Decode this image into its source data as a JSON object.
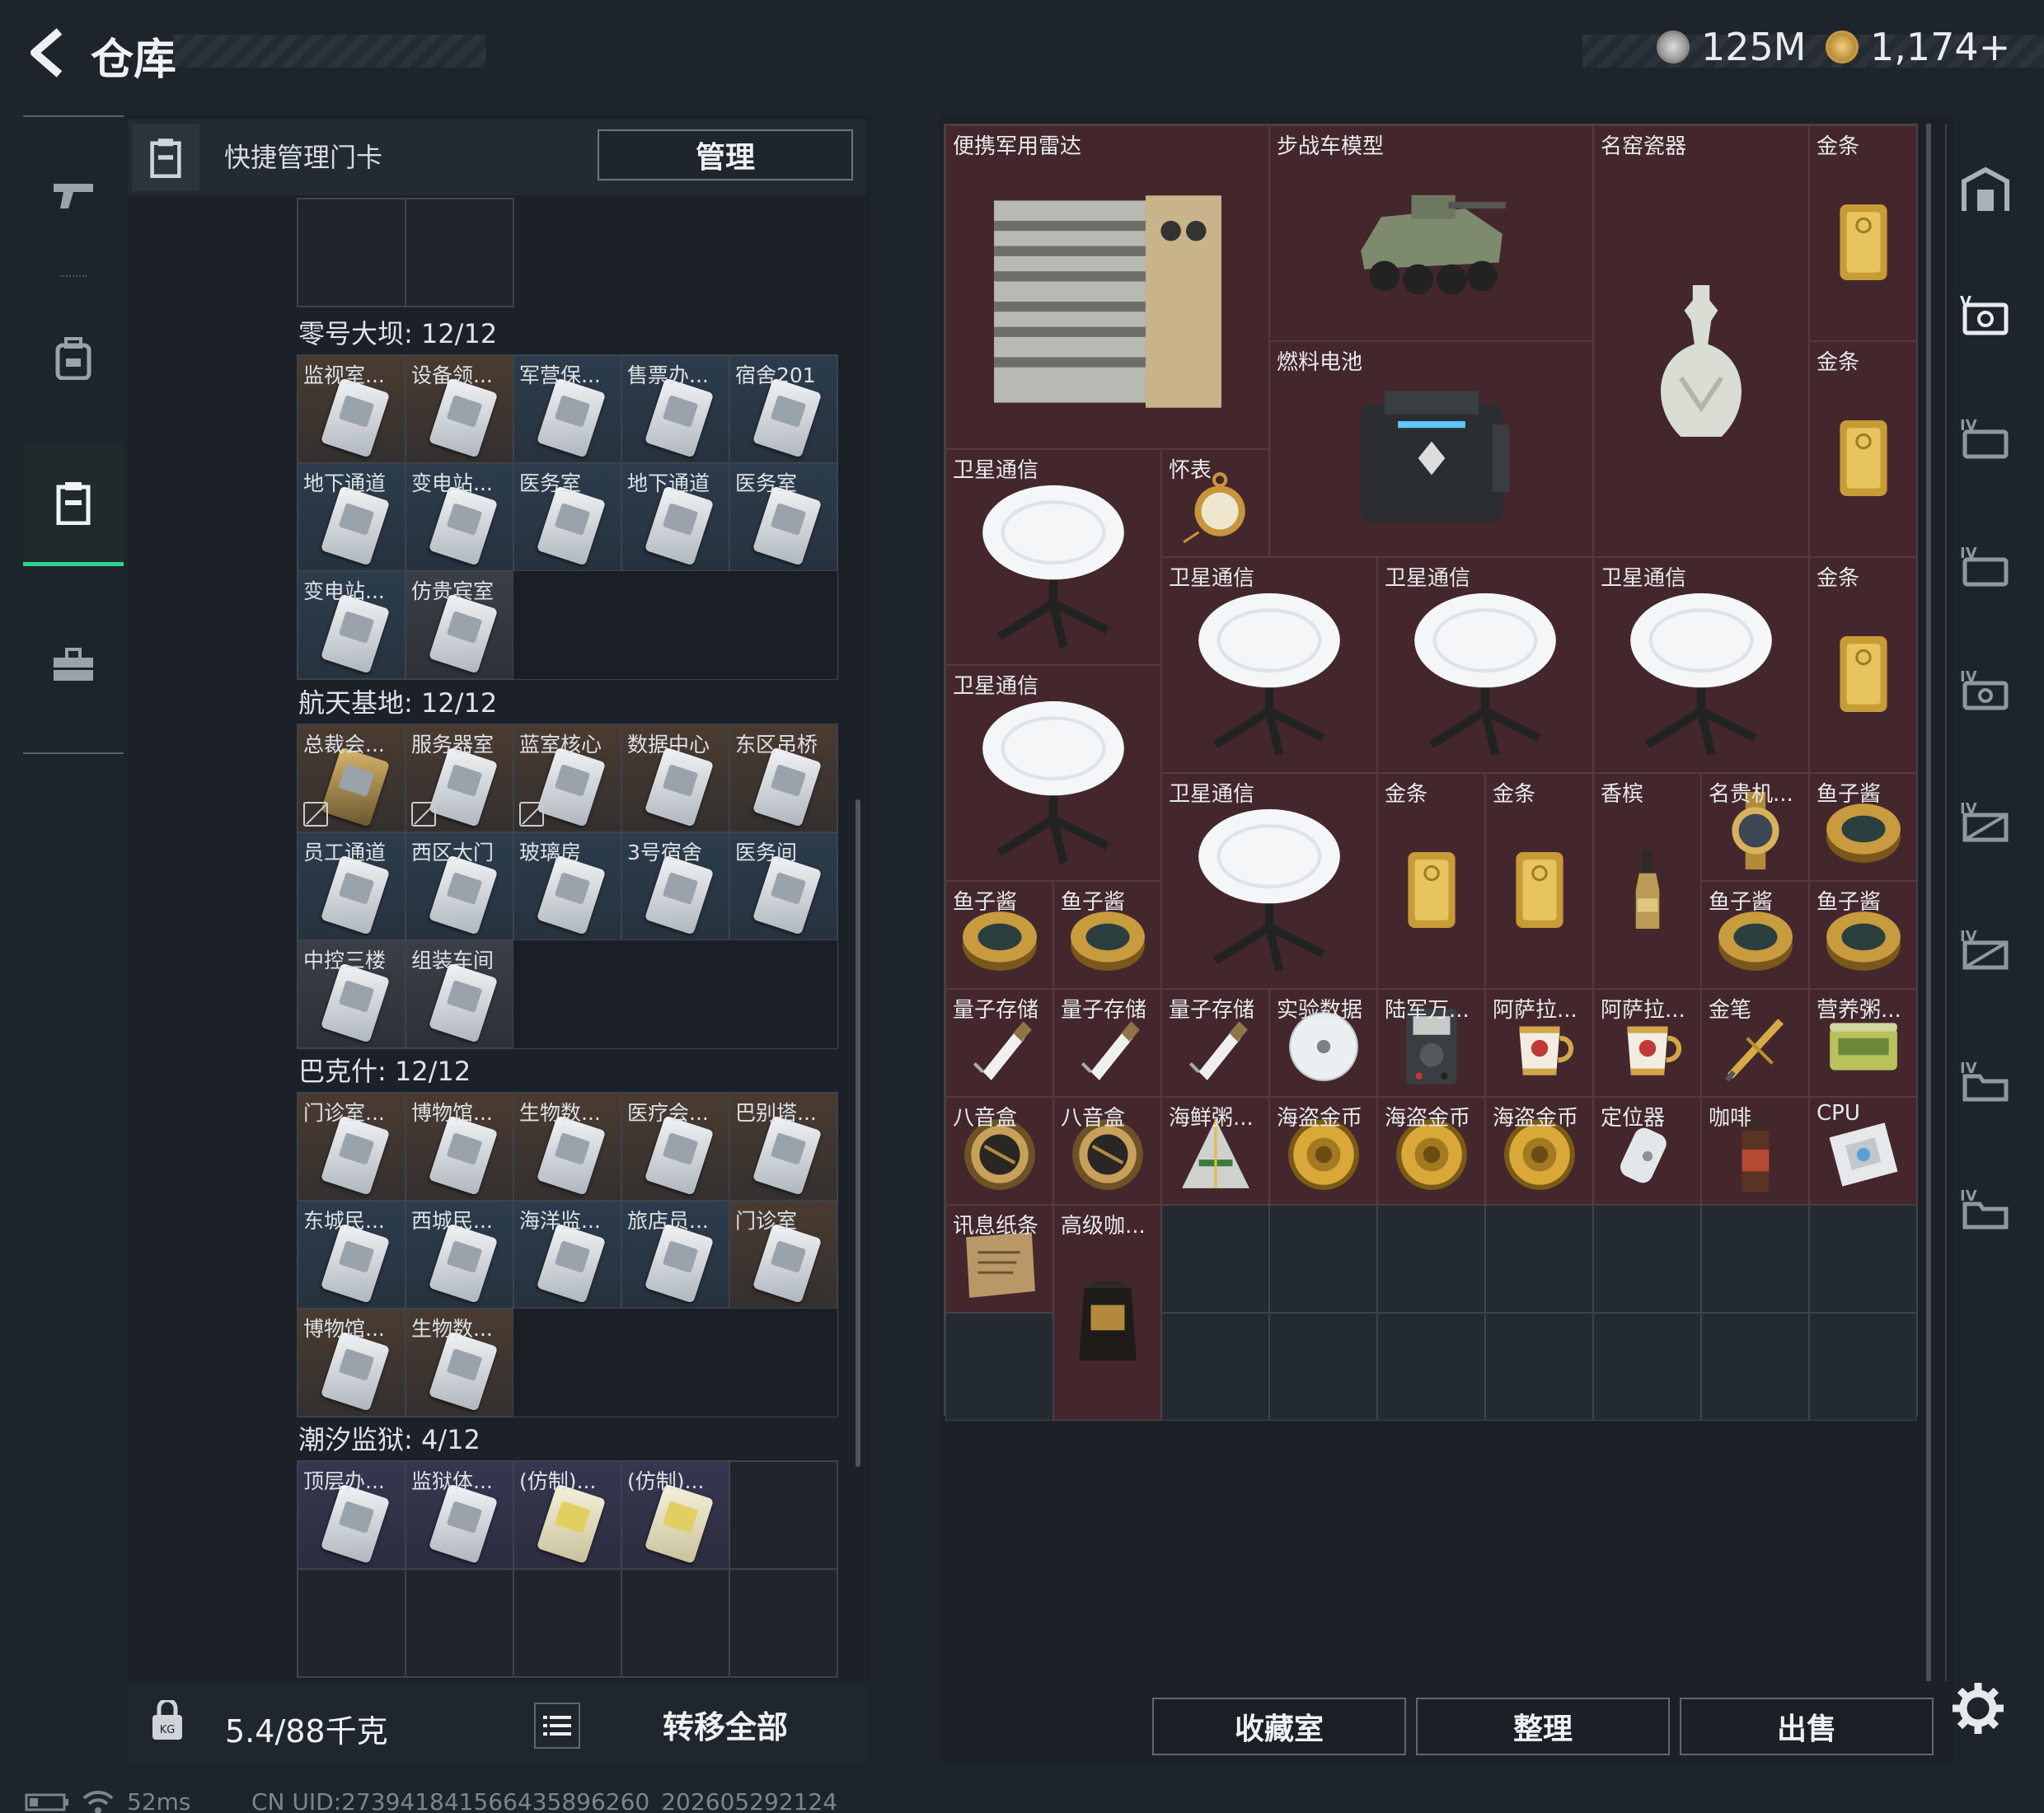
{
  "header": {
    "title": "仓库",
    "currency1": "125M",
    "currency2": "1,174+"
  },
  "left_panel": {
    "header_label": "快捷管理门卡",
    "manage_label": "管理",
    "sections": [
      {
        "title": "零号大坝: 12/12",
        "cards": [
          {
            "label": "监视室...",
            "tone": "brown"
          },
          {
            "label": "设备领...",
            "tone": "brown"
          },
          {
            "label": "军营保...",
            "tone": "blue"
          },
          {
            "label": "售票办...",
            "tone": "blue"
          },
          {
            "label": "宿舍201",
            "tone": "blue"
          },
          {
            "label": "地下通道",
            "tone": "blue"
          },
          {
            "label": "变电站...",
            "tone": "blue"
          },
          {
            "label": "医务室",
            "tone": "blue"
          },
          {
            "label": "地下通道",
            "tone": "blue"
          },
          {
            "label": "医务室",
            "tone": "blue"
          },
          {
            "label": "变电站...",
            "tone": "blue"
          },
          {
            "label": "仿贵宾室",
            "tone": "gray"
          }
        ]
      },
      {
        "title": "航天基地: 12/12",
        "cards": [
          {
            "label": "总裁会...",
            "tone": "brown",
            "gold": true,
            "key": true
          },
          {
            "label": "服务器室",
            "tone": "brown",
            "key": true
          },
          {
            "label": "蓝室核心",
            "tone": "brown",
            "key": true
          },
          {
            "label": "数据中心",
            "tone": "brown"
          },
          {
            "label": "东区吊桥",
            "tone": "brown"
          },
          {
            "label": "员工通道",
            "tone": "blue"
          },
          {
            "label": "西区大门",
            "tone": "blue"
          },
          {
            "label": "玻璃房",
            "tone": "blue"
          },
          {
            "label": "3号宿舍",
            "tone": "blue"
          },
          {
            "label": "医务间",
            "tone": "blue"
          },
          {
            "label": "中控三楼",
            "tone": "gray"
          },
          {
            "label": "组装车间",
            "tone": "gray"
          }
        ]
      },
      {
        "title": "巴克什: 12/12",
        "cards": [
          {
            "label": "门诊室...",
            "tone": "brown"
          },
          {
            "label": "博物馆...",
            "tone": "brown"
          },
          {
            "label": "生物数...",
            "tone": "brown"
          },
          {
            "label": "医疗会...",
            "tone": "brown"
          },
          {
            "label": "巴别塔...",
            "tone": "brown"
          },
          {
            "label": "东城民...",
            "tone": "blue"
          },
          {
            "label": "西城民...",
            "tone": "blue"
          },
          {
            "label": "海洋监...",
            "tone": "blue"
          },
          {
            "label": "旅店员...",
            "tone": "blue"
          },
          {
            "label": "门诊室",
            "tone": "brown"
          },
          {
            "label": "博物馆...",
            "tone": "brown"
          },
          {
            "label": "生物数...",
            "tone": "brown"
          }
        ]
      },
      {
        "title": "潮汐监狱: 4/12",
        "cards": [
          {
            "label": "顶层办...",
            "tone": "purple"
          },
          {
            "label": "监狱体...",
            "tone": "purple"
          },
          {
            "label": "(仿制)...",
            "tone": "purple",
            "ylw": true
          },
          {
            "label": "(仿制)...",
            "tone": "purple",
            "ylw": true
          },
          {
            "label": "",
            "tone": "empty"
          },
          {
            "label": "",
            "tone": "empty"
          },
          {
            "label": "",
            "tone": "empty"
          },
          {
            "label": "",
            "tone": "empty"
          },
          {
            "label": "",
            "tone": "empty"
          },
          {
            "label": "",
            "tone": "empty"
          }
        ]
      }
    ],
    "weight_value": "5.4",
    "weight_capacity": "/88千克",
    "transfer_label": "转移全部"
  },
  "stash": {
    "items": [
      {
        "label": "便携军用雷达",
        "icon": "radar-icon",
        "col": 0,
        "row": 0,
        "w": 3,
        "h": 3
      },
      {
        "label": "步战车模型",
        "icon": "ifv-model-icon",
        "col": 3,
        "row": 0,
        "w": 3,
        "h": 2
      },
      {
        "label": "名窑瓷器",
        "icon": "vase-icon",
        "col": 6,
        "row": 0,
        "w": 2,
        "h": 4
      },
      {
        "label": "金条",
        "icon": "gold-bar-icon",
        "col": 8,
        "row": 0,
        "w": 1,
        "h": 2
      },
      {
        "label": "燃料电池",
        "icon": "fuel-cell-icon",
        "col": 3,
        "row": 2,
        "w": 3,
        "h": 2
      },
      {
        "label": "金条",
        "icon": "gold-bar-icon",
        "col": 8,
        "row": 2,
        "w": 1,
        "h": 2
      },
      {
        "label": "卫星通信",
        "icon": "satellite-dish-icon",
        "col": 0,
        "row": 3,
        "w": 2,
        "h": 2
      },
      {
        "label": "怀表",
        "icon": "pocket-watch-icon",
        "col": 2,
        "row": 3,
        "w": 1,
        "h": 1
      },
      {
        "label": "卫星通信",
        "icon": "satellite-dish-icon",
        "col": 2,
        "row": 4,
        "w": 2,
        "h": 2
      },
      {
        "label": "卫星通信",
        "icon": "satellite-dish-icon",
        "col": 4,
        "row": 4,
        "w": 2,
        "h": 2
      },
      {
        "label": "卫星通信",
        "icon": "satellite-dish-icon",
        "col": 6,
        "row": 4,
        "w": 2,
        "h": 2
      },
      {
        "label": "金条",
        "icon": "gold-bar-icon",
        "col": 8,
        "row": 4,
        "w": 1,
        "h": 2
      },
      {
        "label": "卫星通信",
        "icon": "satellite-dish-icon",
        "col": 0,
        "row": 5,
        "w": 2,
        "h": 2
      },
      {
        "label": "卫星通信",
        "icon": "satellite-dish-icon",
        "col": 2,
        "row": 6,
        "w": 2,
        "h": 2
      },
      {
        "label": "金条",
        "icon": "gold-bar-icon",
        "col": 4,
        "row": 6,
        "w": 1,
        "h": 2
      },
      {
        "label": "金条",
        "icon": "gold-bar-icon",
        "col": 5,
        "row": 6,
        "w": 1,
        "h": 2
      },
      {
        "label": "香槟",
        "icon": "champagne-icon",
        "col": 6,
        "row": 6,
        "w": 1,
        "h": 2
      },
      {
        "label": "名贵机...",
        "icon": "watch-icon",
        "col": 7,
        "row": 6,
        "w": 1,
        "h": 1
      },
      {
        "label": "鱼子酱",
        "icon": "caviar-icon",
        "col": 8,
        "row": 6,
        "w": 1,
        "h": 1
      },
      {
        "label": "鱼子酱",
        "icon": "caviar-icon",
        "col": 0,
        "row": 7,
        "w": 1,
        "h": 1
      },
      {
        "label": "鱼子酱",
        "icon": "caviar-icon",
        "col": 1,
        "row": 7,
        "w": 1,
        "h": 1
      },
      {
        "label": "鱼子酱",
        "icon": "caviar-icon",
        "col": 7,
        "row": 7,
        "w": 1,
        "h": 1
      },
      {
        "label": "鱼子酱",
        "icon": "caviar-icon",
        "col": 8,
        "row": 7,
        "w": 1,
        "h": 1
      },
      {
        "label": "量子存储",
        "icon": "usb-drive-icon",
        "col": 0,
        "row": 8,
        "w": 1,
        "h": 1
      },
      {
        "label": "量子存储",
        "icon": "usb-drive-icon",
        "col": 1,
        "row": 8,
        "w": 1,
        "h": 1
      },
      {
        "label": "量子存储",
        "icon": "usb-drive-icon",
        "col": 2,
        "row": 8,
        "w": 1,
        "h": 1
      },
      {
        "label": "实验数据",
        "icon": "disc-icon",
        "col": 3,
        "row": 8,
        "w": 1,
        "h": 1
      },
      {
        "label": "陆军万...",
        "icon": "multimeter-icon",
        "col": 4,
        "row": 8,
        "w": 1,
        "h": 1
      },
      {
        "label": "阿萨拉...",
        "icon": "teapot-icon",
        "col": 5,
        "row": 8,
        "w": 1,
        "h": 1
      },
      {
        "label": "阿萨拉...",
        "icon": "teapot-icon",
        "col": 6,
        "row": 8,
        "w": 1,
        "h": 1
      },
      {
        "label": "金笔",
        "icon": "gold-pen-icon",
        "col": 7,
        "row": 8,
        "w": 1,
        "h": 1
      },
      {
        "label": "营养粥...",
        "icon": "porridge-can-icon",
        "col": 8,
        "row": 8,
        "w": 1,
        "h": 1
      },
      {
        "label": "八音盒",
        "icon": "music-box-icon",
        "col": 0,
        "row": 9,
        "w": 1,
        "h": 1
      },
      {
        "label": "八音盒",
        "icon": "music-box-icon",
        "col": 1,
        "row": 9,
        "w": 1,
        "h": 1
      },
      {
        "label": "海鲜粥...",
        "icon": "seafood-porridge-icon",
        "col": 2,
        "row": 9,
        "w": 1,
        "h": 1
      },
      {
        "label": "海盗金币",
        "icon": "pirate-coin-icon",
        "col": 3,
        "row": 9,
        "w": 1,
        "h": 1
      },
      {
        "label": "海盗金币",
        "icon": "pirate-coin-icon",
        "col": 4,
        "row": 9,
        "w": 1,
        "h": 1
      },
      {
        "label": "海盗金币",
        "icon": "pirate-coin-icon",
        "col": 5,
        "row": 9,
        "w": 1,
        "h": 1
      },
      {
        "label": "定位器",
        "icon": "locator-icon",
        "col": 6,
        "row": 9,
        "w": 1,
        "h": 1
      },
      {
        "label": "咖啡",
        "icon": "coffee-bottle-icon",
        "col": 7,
        "row": 9,
        "w": 1,
        "h": 1
      },
      {
        "label": "CPU",
        "icon": "cpu-icon",
        "col": 8,
        "row": 9,
        "w": 1,
        "h": 1
      },
      {
        "label": "讯息纸条",
        "icon": "paper-note-icon",
        "col": 0,
        "row": 10,
        "w": 1,
        "h": 1
      },
      {
        "label": "高级咖...",
        "icon": "coffee-bag-icon",
        "col": 1,
        "row": 10,
        "w": 1,
        "h": 2
      }
    ]
  },
  "bottom_buttons": {
    "collection": "收藏室",
    "sort": "整理",
    "sell": "出售"
  },
  "status_bar": {
    "ping": "52ms",
    "uid": "CN UID:273941841566435896260_202605292124"
  },
  "colors": {
    "active_accent": "#2fd38b",
    "item_bg": "#43272c"
  }
}
